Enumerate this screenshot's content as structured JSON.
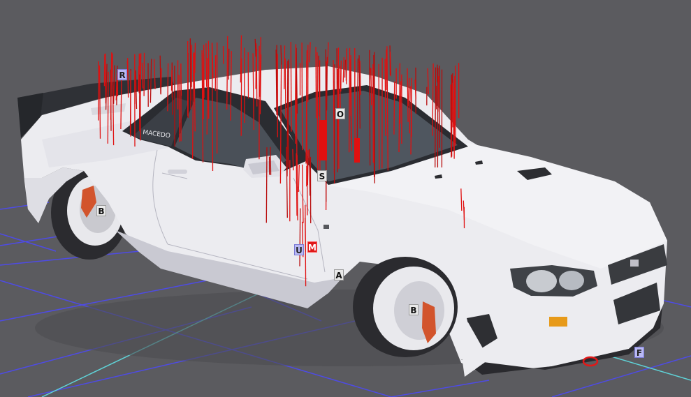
{
  "scene": {
    "colors": {
      "background": "#5b5b5f",
      "grid_line": "#4e4be6",
      "grid_axis": "#5fd3d8",
      "car_body": "#ececf0",
      "car_shadow": "#b8b8c2",
      "glass": "#4a5058",
      "tire": "#2b2b2f",
      "force_line": "#e01010",
      "caliper": "#d2542c"
    },
    "decal_text": "MACEDO"
  },
  "markers": {
    "R": "R",
    "O": "O",
    "S": "S",
    "B_rear": "B",
    "B_front": "B",
    "U": "U",
    "M": "M",
    "A": "A",
    "F": "F"
  }
}
